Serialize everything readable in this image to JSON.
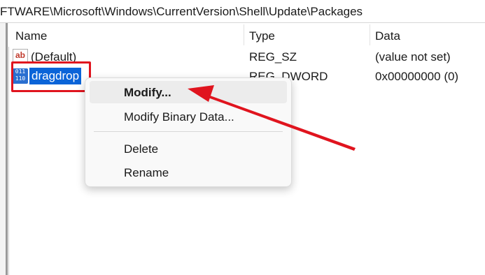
{
  "address": {
    "path": "FTWARE\\Microsoft\\Windows\\CurrentVersion\\Shell\\Update\\Packages"
  },
  "columns": {
    "name": "Name",
    "type": "Type",
    "data": "Data"
  },
  "rows": [
    {
      "name": "(Default)",
      "type": "REG_SZ",
      "data": "(value not set)",
      "icon": "string-value-icon"
    },
    {
      "name": "dragdrop",
      "type": "REG_DWORD",
      "data": "0x00000000 (0)",
      "icon": "binary-value-icon"
    }
  ],
  "icons": {
    "string_glyph": "ab",
    "binary_glyph": "011 110"
  },
  "context_menu": {
    "items": [
      {
        "label": "Modify..."
      },
      {
        "label": "Modify Binary Data..."
      },
      {
        "label": "Delete"
      },
      {
        "label": "Rename"
      }
    ]
  },
  "colors": {
    "selection": "#0a64d8",
    "annotation_red": "#e0141e"
  }
}
